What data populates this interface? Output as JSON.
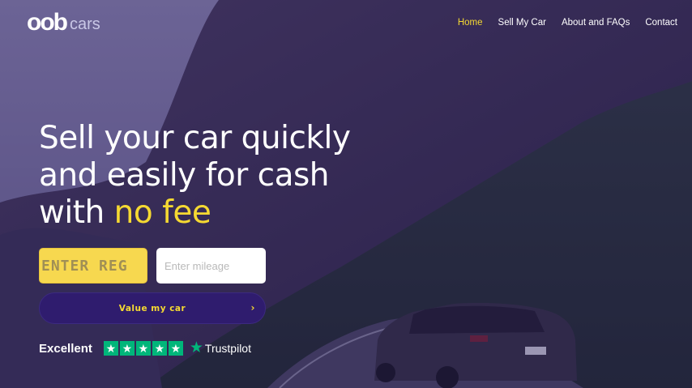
{
  "logo": {
    "mark": "oob",
    "text": "cars"
  },
  "nav": [
    {
      "label": "Home",
      "active": true
    },
    {
      "label": "Sell My Car",
      "active": false
    },
    {
      "label": "About and FAQs",
      "active": false
    },
    {
      "label": "Contact",
      "active": false
    }
  ],
  "hero": {
    "headline_line1": "Sell your car quickly",
    "headline_line2": "and easily for cash",
    "headline_line3_prefix": "with ",
    "headline_highlight": "no fee"
  },
  "form": {
    "reg_placeholder": "ENTER REG",
    "reg_value": "",
    "mileage_placeholder": "Enter mileage",
    "mileage_value": "",
    "submit_label": "Value my car",
    "submit_chevron": "›"
  },
  "trustpilot": {
    "rating_label": "Excellent",
    "stars": 5,
    "brand": "Trustpilot"
  },
  "colors": {
    "accent": "#f5d932",
    "overlay": "#2a1c5e",
    "trustpilot_green": "#00b67a"
  }
}
